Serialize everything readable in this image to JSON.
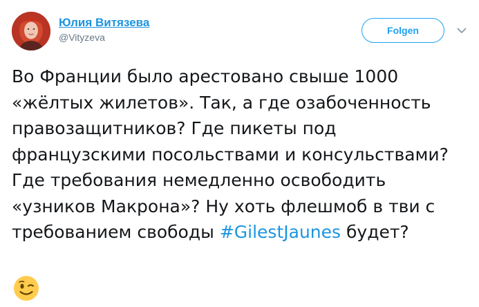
{
  "author": {
    "name": "Юлия Витязева",
    "handle": "@Vityzeva",
    "avatar_icon": "user-avatar-photo"
  },
  "actions": {
    "follow_label": "Folgen",
    "more_icon": "chevron-down-icon"
  },
  "tweet": {
    "text_before_hashtag": "Во Франции было арестовано свыше 1000 «жёлтых жилетов». Так, а где озабоченность правозащитников? Где пикеты под французскими посольствами и консульствами? Где требования немедленно освободить «узников Макрона»? Ну хоть флешмоб в тви с требованием свободы ",
    "hashtag": "#GilestJaunes",
    "text_after_hashtag": " будет?",
    "emoji_icon": "winking-face-emoji"
  },
  "colors": {
    "link": "#1b95e0",
    "text": "#14171a",
    "secondary": "#657786",
    "accent": "#1da1f2"
  }
}
